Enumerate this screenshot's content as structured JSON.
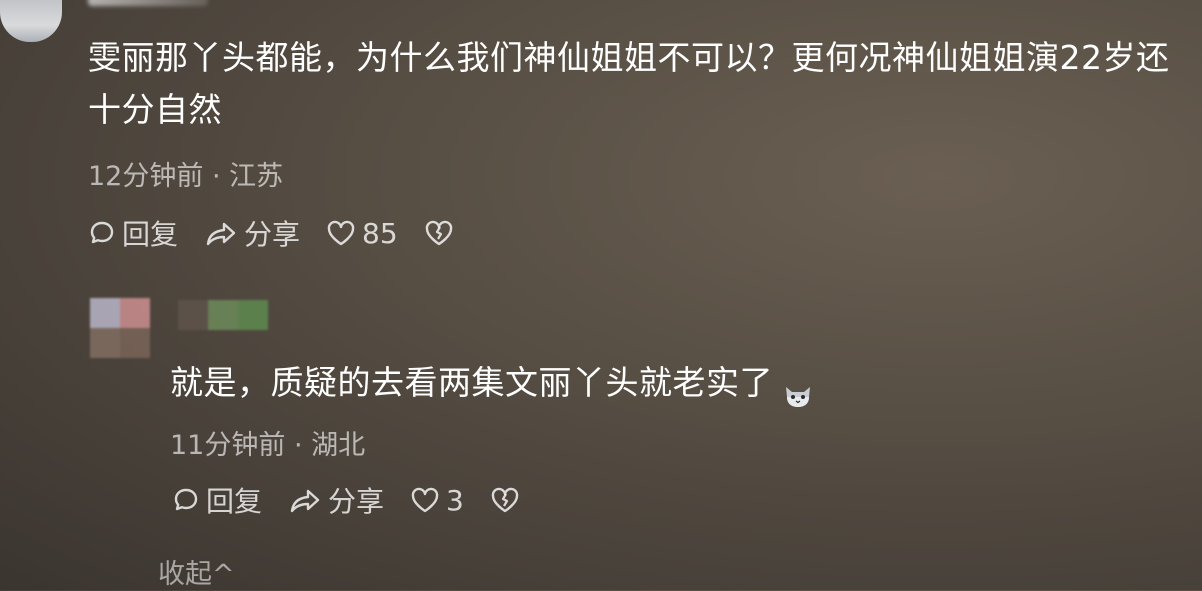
{
  "comment1": {
    "text": "雯丽那丫头都能，为什么我们神仙姐姐不可以？更何况神仙姐姐演22岁还十分自然",
    "meta": "12分钟前 · 江苏",
    "reply_label": "回复",
    "share_label": "分享",
    "like_count": "85"
  },
  "comment2": {
    "text": "就是，质疑的去看两集文丽丫头就老实了",
    "meta": "11分钟前 · 湖北",
    "reply_label": "回复",
    "share_label": "分享",
    "like_count": "3"
  },
  "collapse_label": "收起^",
  "icons": {
    "reply": "chat-bubble-icon",
    "share": "share-arrow-icon",
    "like": "heart-icon",
    "dislike": "broken-heart-icon",
    "emoji": "cat-face-emoji"
  }
}
